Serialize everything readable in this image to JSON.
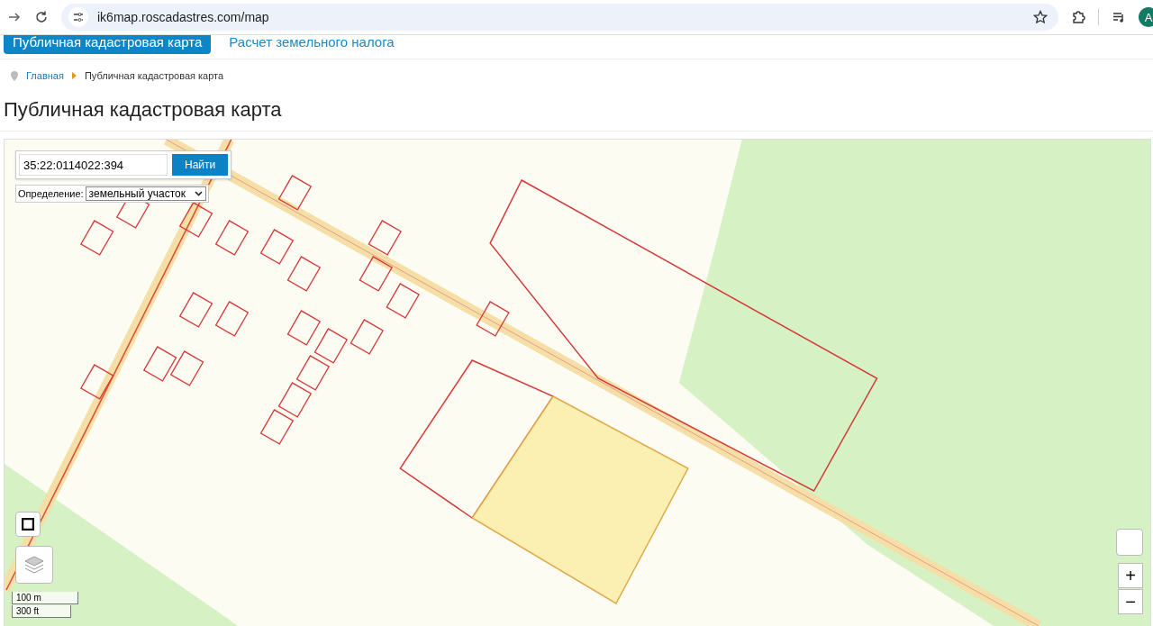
{
  "browser": {
    "url": "ik6map.roscadastres.com/map",
    "avatar": "A"
  },
  "nav": {
    "tabs": [
      {
        "label": "Публичная кадастровая карта",
        "selected": true
      },
      {
        "label": "Расчет земельного налога",
        "selected": false
      }
    ]
  },
  "breadcrumbs": [
    {
      "label": "Главная",
      "link": true
    },
    {
      "label": "Публичная кадастровая карта",
      "link": false
    }
  ],
  "heading": "Публичная кадастровая карта",
  "map": {
    "search": {
      "value": "35:22:0114022:394",
      "button": "Найти"
    },
    "definition": {
      "label": "Определение:",
      "value": "земельный участок"
    },
    "zoom": {
      "in": "+",
      "out": "−"
    },
    "scale": [
      "100 m",
      "300 ft"
    ]
  }
}
